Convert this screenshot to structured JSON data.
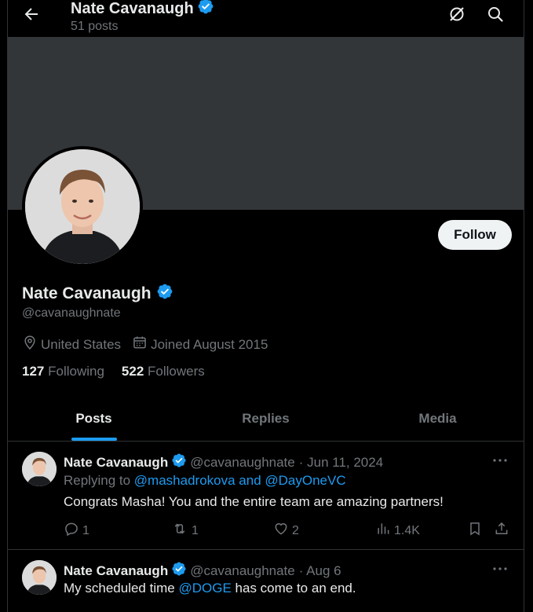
{
  "header": {
    "name": "Nate Cavanaugh",
    "posts_count": "51 posts"
  },
  "profile": {
    "name": "Nate Cavanaugh",
    "handle": "@cavanaughnate",
    "location": "United States",
    "joined": "Joined August 2015",
    "following_count": "127",
    "following_label": "Following",
    "followers_count": "522",
    "followers_label": "Followers",
    "follow_button": "Follow"
  },
  "tabs": [
    {
      "label": "Posts",
      "active": true
    },
    {
      "label": "Replies",
      "active": false
    },
    {
      "label": "Media",
      "active": false
    }
  ],
  "tweets": [
    {
      "name": "Nate Cavanaugh",
      "handle": "@cavanaughnate",
      "date": "· Jun 11, 2024",
      "replying_prefix": "Replying to",
      "replying_mentions": "@mashadrokova and @DayOneVC",
      "text": "Congrats Masha! You and the entire team are amazing partners!",
      "replies": "1",
      "reposts": "1",
      "likes": "2",
      "views": "1.4K"
    },
    {
      "name": "Nate Cavanaugh",
      "handle": "@cavanaughnate",
      "date": "· Aug 6",
      "text_before": "My scheduled time",
      "mention": "@DOGE",
      "text_after": "has come to an end."
    }
  ],
  "colors": {
    "accent": "#1d9bf0",
    "banner": "#333639",
    "text": "#e7e9ea",
    "muted": "#71767b"
  }
}
